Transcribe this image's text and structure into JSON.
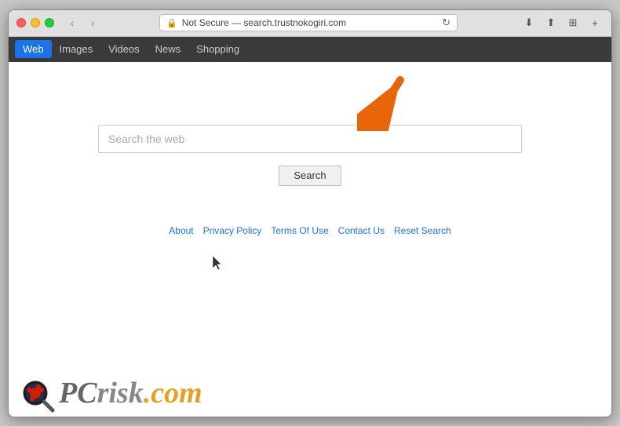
{
  "browser": {
    "address": "Not Secure — search.trustnokogiri.com",
    "address_icon": "🔒",
    "nav_back_icon": "‹",
    "nav_forward_icon": "›",
    "reload_icon": "↻",
    "download_icon": "⬇",
    "share_icon": "⬆",
    "sidebar_icon": "⊞",
    "new_tab_icon": "+"
  },
  "nav_tabs": [
    {
      "label": "Web",
      "active": true
    },
    {
      "label": "Images",
      "active": false
    },
    {
      "label": "Videos",
      "active": false
    },
    {
      "label": "News",
      "active": false
    },
    {
      "label": "Shopping",
      "active": false
    }
  ],
  "search": {
    "placeholder": "Search the web",
    "button_label": "Search"
  },
  "footer": {
    "links": [
      {
        "label": "About"
      },
      {
        "label": "Privacy Policy"
      },
      {
        "label": "Terms Of Use"
      },
      {
        "label": "Contact Us"
      },
      {
        "label": "Reset Search"
      }
    ]
  },
  "watermark": {
    "brand": "PC",
    "suffix": "risk",
    "tld": ".com"
  }
}
